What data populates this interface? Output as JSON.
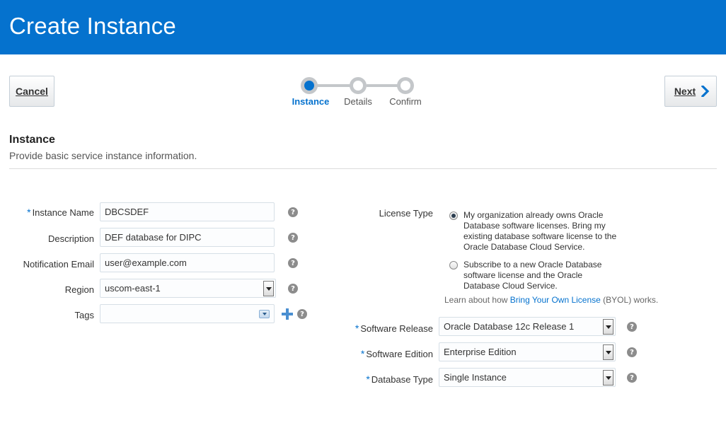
{
  "header": {
    "title": "Create Instance"
  },
  "buttons": {
    "cancel_label": "Cancel",
    "next_label": "Next"
  },
  "train": {
    "steps": [
      {
        "label": "Instance",
        "active": true
      },
      {
        "label": "Details",
        "active": false
      },
      {
        "label": "Confirm",
        "active": false
      }
    ]
  },
  "section": {
    "title": "Instance",
    "subtitle": "Provide basic service instance information."
  },
  "left_form": {
    "instance_name": {
      "label": "Instance Name",
      "required": true,
      "value": "DBCSDEF"
    },
    "description": {
      "label": "Description",
      "value": "DEF database for DIPC"
    },
    "notification_email": {
      "label": "Notification Email",
      "value": "user@example.com"
    },
    "region": {
      "label": "Region",
      "value": "uscom-east-1"
    },
    "tags": {
      "label": "Tags",
      "value": ""
    }
  },
  "right_form": {
    "license_type": {
      "label": "License Type",
      "options": [
        {
          "text": "My organization already owns Oracle Database software licenses. Bring my existing database software license to the Oracle Database Cloud Service.",
          "selected": true
        },
        {
          "text": "Subscribe to a new Oracle Database software license and the Oracle Database Cloud Service.",
          "selected": false
        }
      ],
      "learn_prefix": "Learn about how ",
      "learn_link": "Bring Your Own License",
      "learn_suffix": " (BYOL) works."
    },
    "software_release": {
      "label": "Software Release",
      "required": true,
      "value": "Oracle Database 12c Release 1"
    },
    "software_edition": {
      "label": "Software Edition",
      "required": true,
      "value": "Enterprise Edition"
    },
    "database_type": {
      "label": "Database Type",
      "required": true,
      "value": "Single Instance"
    }
  },
  "icons": {
    "help": "?",
    "required_marker": "*",
    "add_tag": "plus-icon",
    "next_chevron": "chevron-right-icon"
  },
  "colors": {
    "brand_blue": "#0572ce",
    "help_gray": "#8c8c8c"
  }
}
